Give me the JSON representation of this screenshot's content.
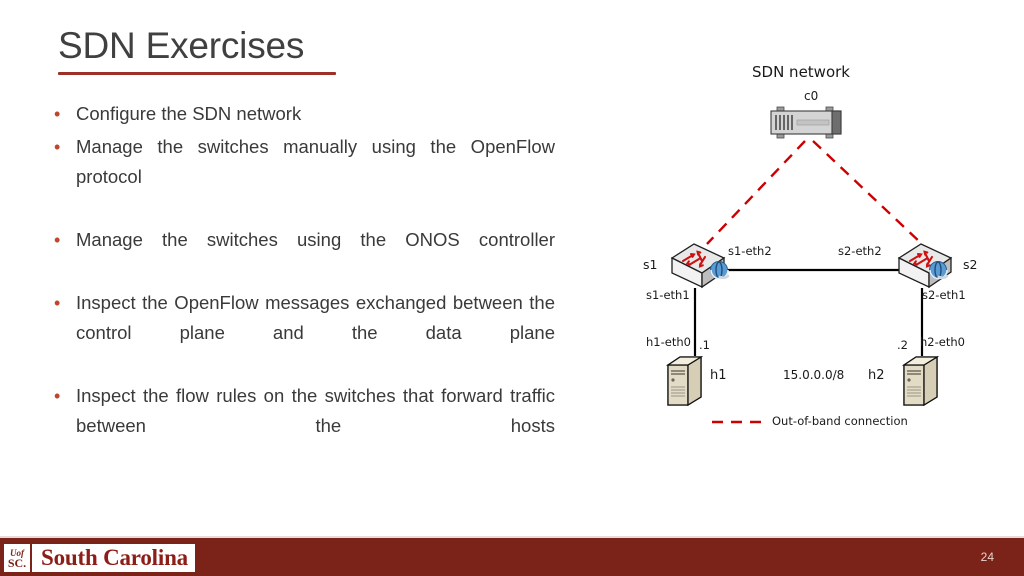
{
  "slide": {
    "title": "SDN Exercises",
    "page_number": "24",
    "accent_color": "#9C3028",
    "footer_color": "#7B2318",
    "bullet_marker_color": "#C0462A"
  },
  "bullets": [
    {
      "text": "Configure the SDN network",
      "justified": false
    },
    {
      "text": "Manage the switches manually using the OpenFlow protocol",
      "justified": true
    },
    {
      "text": "Manage the switches using the ONOS controller",
      "justified": true
    },
    {
      "text": "Inspect the OpenFlow messages exchanged between the control plane and the data plane",
      "justified": true
    },
    {
      "text": "Inspect the flow rules on the switches that forward traffic between the hosts",
      "justified": true
    }
  ],
  "diagram": {
    "title": "SDN network",
    "controller": {
      "label": "c0"
    },
    "switches": [
      {
        "id": "s1",
        "label": "s1",
        "port_top": "s1-eth2",
        "port_bottom": "s1-eth1"
      },
      {
        "id": "s2",
        "label": "s2",
        "port_top": "s2-eth2",
        "port_bottom": "s2-eth1"
      }
    ],
    "hosts": [
      {
        "id": "h1",
        "label": "h1",
        "port": "h1-eth0",
        "ip_suffix": ".1"
      },
      {
        "id": "h2",
        "label": "h2",
        "port": "h2-eth0",
        "ip_suffix": ".2"
      }
    ],
    "subnet": "15.0.0.0/8",
    "legend": {
      "label": "Out-of-band connection",
      "color": "#CC0000",
      "style": "dashed"
    },
    "link_color": "#000000"
  },
  "footer": {
    "logo_line1": "Uof",
    "logo_line2": "SC.",
    "logo_word": "South Carolina"
  }
}
